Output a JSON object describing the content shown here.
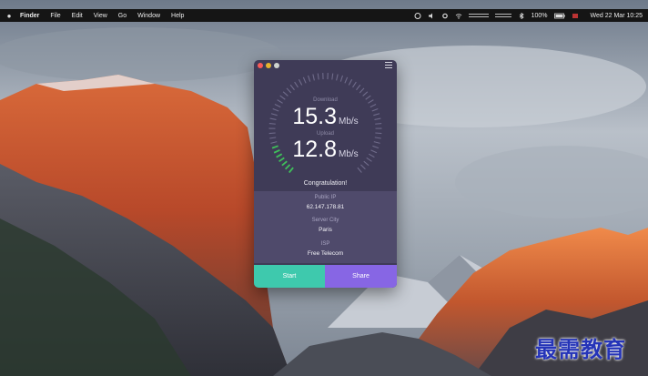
{
  "menubar": {
    "app_name": "Finder",
    "items": [
      "File",
      "Edit",
      "View",
      "Go",
      "Window",
      "Help"
    ],
    "battery": "100%",
    "clock": "Wed 22 Mar 10:25"
  },
  "app": {
    "download": {
      "label": "Download",
      "value": "15.3",
      "unit": "Mb/s"
    },
    "upload": {
      "label": "Upload",
      "value": "12.8",
      "unit": "Mb/s"
    },
    "message": "Congratulation!",
    "public_ip": {
      "label": "Public IP",
      "value": "62.147.178.81"
    },
    "server_city": {
      "label": "Server City",
      "value": "Paris"
    },
    "isp": {
      "label": "ISP",
      "value": "Free Telecom"
    },
    "buttons": {
      "start": "Start",
      "share": "Share"
    },
    "colors": {
      "start": "#3ec9ad",
      "share": "#8766e4",
      "gauge_active": "#3fbf5a"
    }
  },
  "watermark": "最需教育"
}
